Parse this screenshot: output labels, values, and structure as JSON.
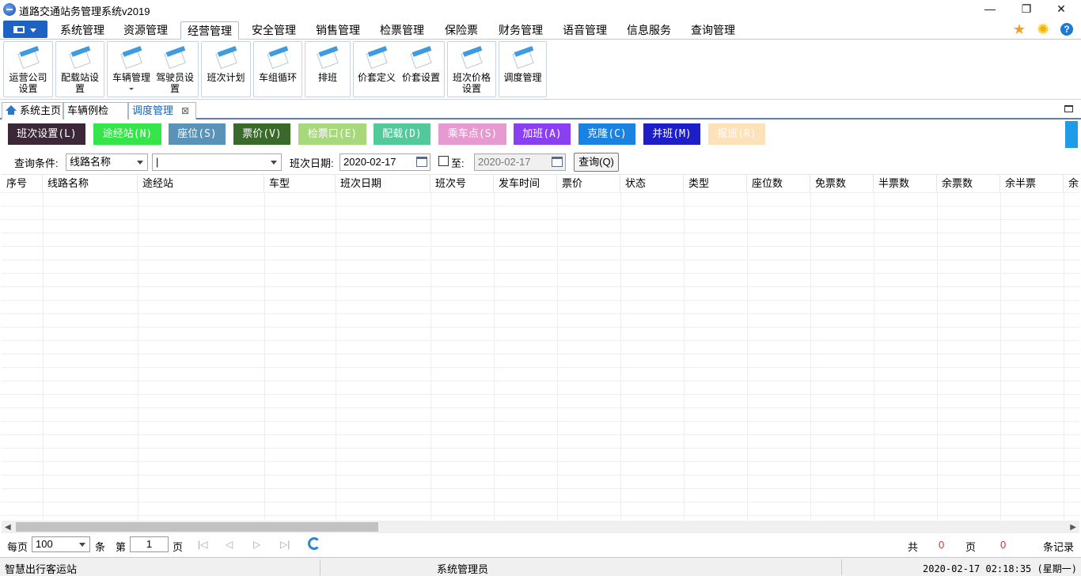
{
  "window": {
    "title": "道路交通站务管理系统v2019",
    "minimize": "—",
    "restore": "❐",
    "close": "✕"
  },
  "menu": {
    "tabs": [
      "系统管理",
      "资源管理",
      "经营管理",
      "安全管理",
      "销售管理",
      "检票管理",
      "保险票",
      "财务管理",
      "语音管理",
      "信息服务",
      "查询管理"
    ],
    "active": "经营管理",
    "right_icons": [
      "star-icon",
      "gear-icon",
      "help-icon"
    ]
  },
  "ribbon": {
    "buttons": [
      {
        "label1": "运营公司",
        "label2": "设置"
      },
      {
        "label1": "配载站设",
        "label2": "置"
      },
      {
        "label1": "车辆管理",
        "label2": ""
      },
      {
        "label1": "驾驶员设",
        "label2": "置"
      },
      {
        "label1": "班次计划",
        "label2": ""
      },
      {
        "label1": "车组循环",
        "label2": ""
      },
      {
        "label1": "排班",
        "label2": ""
      },
      {
        "label1": "价套定义",
        "label2": ""
      },
      {
        "label1": "价套设置",
        "label2": ""
      },
      {
        "label1": "班次价格",
        "label2": "设置"
      },
      {
        "label1": "调度管理",
        "label2": ""
      }
    ]
  },
  "doc_tabs": {
    "home": "系统主页",
    "tab2": "车辆例检",
    "tab3": "调度管理",
    "close": "⊠"
  },
  "actions": {
    "buttons": [
      {
        "label": "班次设置(L)",
        "color": "#3c2738"
      },
      {
        "label": "途经站(N)",
        "color": "#35e64a"
      },
      {
        "label": "座位(S)",
        "color": "#5a93b8"
      },
      {
        "label": "票价(V)",
        "color": "#3a6a2a"
      },
      {
        "label": "检票口(E)",
        "color": "#a8d87c"
      },
      {
        "label": "配载(D)",
        "color": "#52c99a"
      },
      {
        "label": "乘车点(S)",
        "color": "#e69ad0"
      },
      {
        "label": "加班(A)",
        "color": "#8a3ff2"
      },
      {
        "label": "克隆(C)",
        "color": "#1a82e0"
      },
      {
        "label": "并班(M)",
        "color": "#1e1ec8"
      },
      {
        "label": "报班(R)",
        "color": "#fde1b8"
      }
    ]
  },
  "query": {
    "condition_label": "查询条件:",
    "condition_value": "线路名称",
    "keyword_value": "|",
    "date_label": "班次日期:",
    "date_from": "2020-02-17",
    "to_label": "至:",
    "date_to": "2020-02-17",
    "to_checked": false,
    "search_button": "查询(Q)"
  },
  "table": {
    "columns": [
      "序号",
      "线路名称",
      "途经站",
      "车型",
      "班次日期",
      "班次号",
      "发车时间",
      "票价",
      "状态",
      "类型",
      "座位数",
      "免票数",
      "半票数",
      "余票数",
      "余半票",
      "余"
    ],
    "rows": []
  },
  "pager": {
    "per_page_label": "每页",
    "per_page": "100",
    "unit": "条",
    "page_prefix": "第",
    "page": "1",
    "page_suffix": "页",
    "total_prefix": "共",
    "total_pages": "0",
    "pages_label": "页",
    "total_records": "0",
    "records_label": "条记录",
    "nav": [
      "|◁",
      "◁",
      "▷",
      "▷|"
    ]
  },
  "status": {
    "left": "智慧出行客运站",
    "center": "系统管理员",
    "right": "2020-02-17 02:18:35 (星期一)"
  }
}
